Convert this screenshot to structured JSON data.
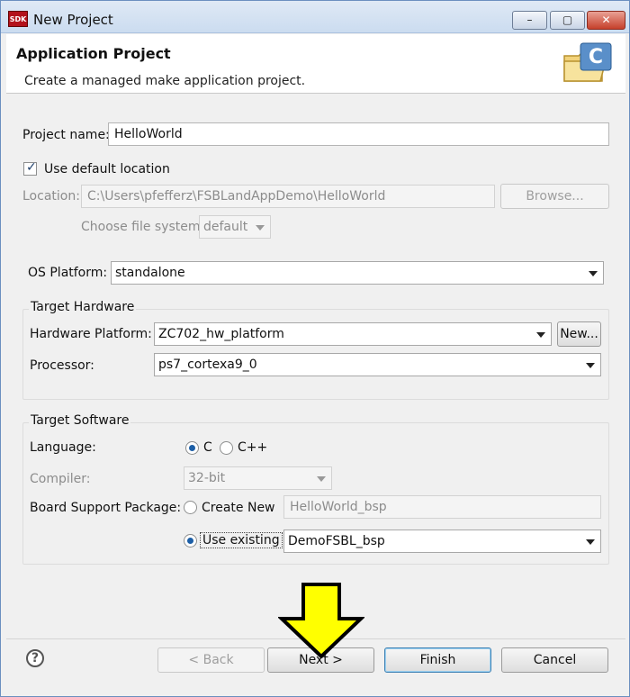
{
  "window": {
    "app_icon_text": "SDK",
    "title": "New Project",
    "minimize_glyph": "–",
    "maximize_glyph": "▢",
    "close_glyph": "✕"
  },
  "banner": {
    "title": "Application Project",
    "description": "Create a managed make application project.",
    "icon": "new-c-project-folder-icon"
  },
  "project": {
    "name_label": "Project name:",
    "name_value": "HelloWorld",
    "use_default_location_label": "Use default location",
    "use_default_location_checked": true,
    "location_label": "Location:",
    "location_value": "C:\\Users\\pfefferz\\FSBLandAppDemo\\HelloWorld",
    "browse_label": "Browse...",
    "file_system_label": "Choose file system:",
    "file_system_value": "default"
  },
  "os_platform": {
    "label": "OS Platform:",
    "value": "standalone"
  },
  "target_hardware": {
    "title": "Target Hardware",
    "hardware_platform_label": "Hardware Platform:",
    "hardware_platform_value": "ZC702_hw_platform",
    "new_button_label": "New...",
    "processor_label": "Processor:",
    "processor_value": "ps7_cortexa9_0"
  },
  "target_software": {
    "title": "Target Software",
    "language_label": "Language:",
    "language_options": [
      "C",
      "C++"
    ],
    "language_selected": "C",
    "compiler_label": "Compiler:",
    "compiler_value": "32-bit",
    "bsp_label": "Board Support Package:",
    "create_new_label": "Create New",
    "create_new_value": "HelloWorld_bsp",
    "use_existing_label": "Use existing",
    "use_existing_value": "DemoFSBL_bsp",
    "bsp_selected": "Use existing"
  },
  "footer": {
    "help_glyph": "?",
    "back_label": "< Back",
    "next_label": "Next >",
    "finish_label": "Finish",
    "cancel_label": "Cancel"
  },
  "colors": {
    "annotation_arrow_fill": "#ffff00",
    "annotation_arrow_stroke": "#000000",
    "radio_selected": "#1c5ea6"
  }
}
